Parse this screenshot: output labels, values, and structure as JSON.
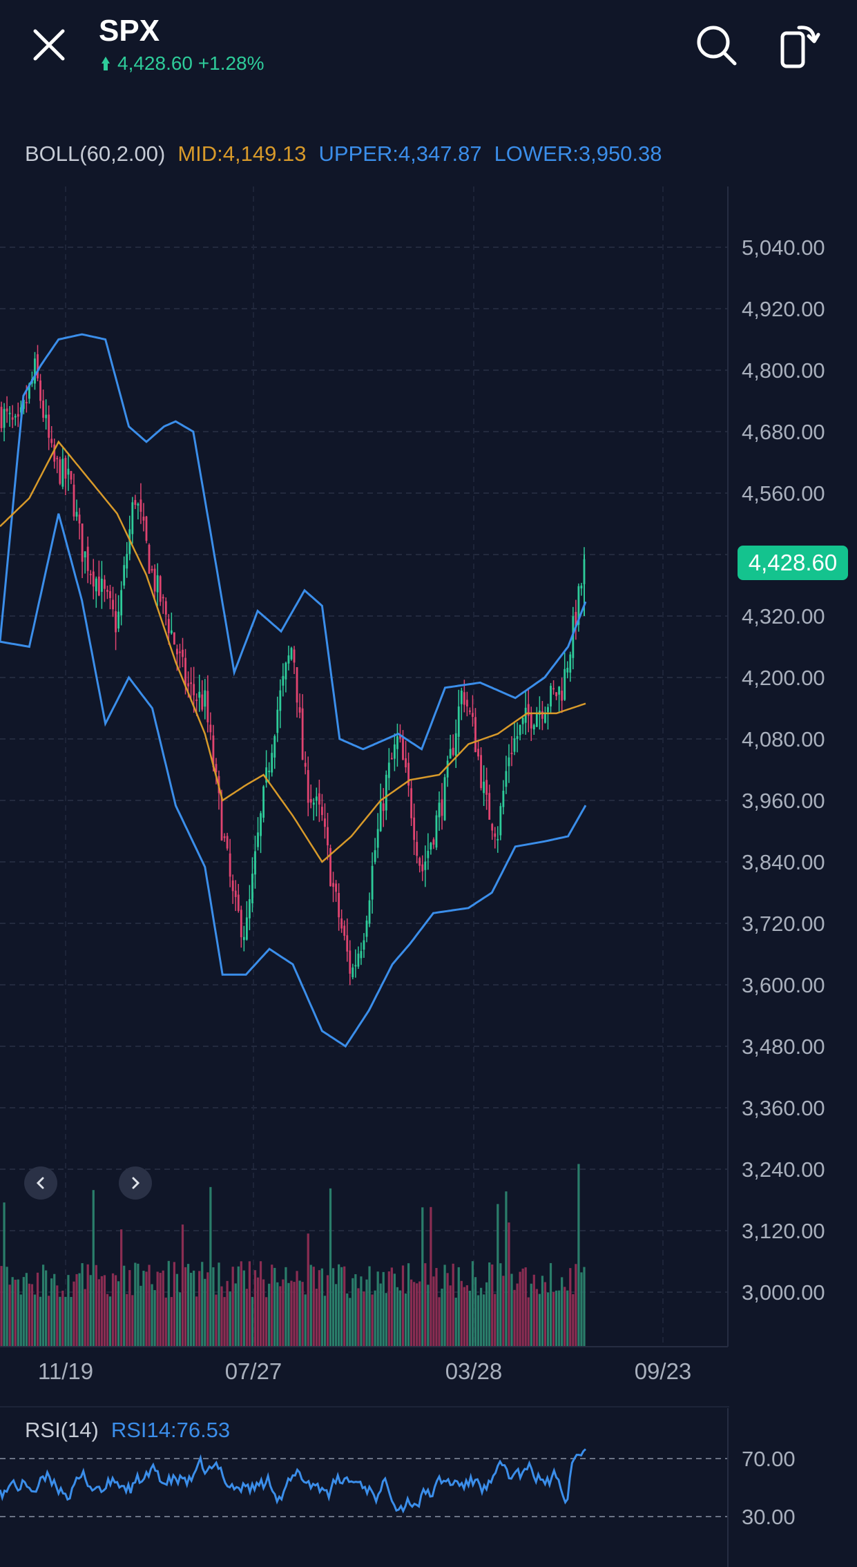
{
  "header": {
    "close_icon": "close-icon",
    "symbol": "SPX",
    "price_change": "4,428.60 +1.28%",
    "up_color": "#2ecc9a",
    "search_icon": "search-icon",
    "rotate_icon": "rotate-screen-icon"
  },
  "indicator": {
    "name": "BOLL(60,2.00)",
    "mid": "MID:4,149.13",
    "upper": "UPPER:4,347.87",
    "lower": "LOWER:3,950.38"
  },
  "current_price": "4,428.60",
  "nav": {
    "prev_icon": "chevron-left-icon",
    "next_icon": "chevron-right-icon"
  },
  "rsi": {
    "name": "RSI(14)",
    "value": "RSI14:76.53"
  },
  "colors": {
    "background": "#101628",
    "up": "#2ecc9a",
    "down": "#e04470",
    "boll_mid": "#d89a2a",
    "boll_band": "#3b8eea",
    "badge": "#14c38e"
  },
  "chart_data": [
    {
      "type": "candlestick",
      "title": "SPX",
      "ylim": [
        2940,
        5100
      ],
      "y_ticks": [
        "5,040.00",
        "4,920.00",
        "4,800.00",
        "4,680.00",
        "4,560.00",
        "4,440.00",
        "4,320.00",
        "4,200.00",
        "4,080.00",
        "3,960.00",
        "3,840.00",
        "3,720.00",
        "3,600.00",
        "3,480.00",
        "3,360.00",
        "3,240.00",
        "3,120.00",
        "3,000.00"
      ],
      "x_ticks": [
        "11/19",
        "07/27",
        "03/28",
        "09/23"
      ],
      "boll_mid": [
        [
          0,
          4495
        ],
        [
          0.05,
          4550
        ],
        [
          0.1,
          4660
        ],
        [
          0.15,
          4590
        ],
        [
          0.2,
          4520
        ],
        [
          0.25,
          4400
        ],
        [
          0.3,
          4230
        ],
        [
          0.35,
          4090
        ],
        [
          0.38,
          3960
        ],
        [
          0.42,
          3990
        ],
        [
          0.45,
          4010
        ],
        [
          0.5,
          3930
        ],
        [
          0.55,
          3840
        ],
        [
          0.6,
          3890
        ],
        [
          0.65,
          3960
        ],
        [
          0.7,
          4000
        ],
        [
          0.75,
          4010
        ],
        [
          0.8,
          4070
        ],
        [
          0.85,
          4090
        ],
        [
          0.9,
          4130
        ],
        [
          0.95,
          4130
        ],
        [
          1.0,
          4149.13
        ]
      ],
      "boll_upper": [
        [
          0,
          4270
        ],
        [
          0.04,
          4750
        ],
        [
          0.07,
          4810
        ],
        [
          0.1,
          4860
        ],
        [
          0.14,
          4870
        ],
        [
          0.18,
          4860
        ],
        [
          0.22,
          4690
        ],
        [
          0.25,
          4660
        ],
        [
          0.28,
          4690
        ],
        [
          0.3,
          4700
        ],
        [
          0.33,
          4680
        ],
        [
          0.36,
          4480
        ],
        [
          0.4,
          4210
        ],
        [
          0.44,
          4330
        ],
        [
          0.48,
          4290
        ],
        [
          0.52,
          4370
        ],
        [
          0.55,
          4340
        ],
        [
          0.58,
          4080
        ],
        [
          0.62,
          4060
        ],
        [
          0.68,
          4090
        ],
        [
          0.72,
          4060
        ],
        [
          0.76,
          4180
        ],
        [
          0.82,
          4190
        ],
        [
          0.88,
          4160
        ],
        [
          0.93,
          4200
        ],
        [
          0.97,
          4260
        ],
        [
          1.0,
          4347.87
        ]
      ],
      "boll_lower": [
        [
          0,
          4270
        ],
        [
          0.05,
          4260
        ],
        [
          0.1,
          4520
        ],
        [
          0.14,
          4350
        ],
        [
          0.18,
          4110
        ],
        [
          0.22,
          4200
        ],
        [
          0.26,
          4140
        ],
        [
          0.3,
          3950
        ],
        [
          0.35,
          3830
        ],
        [
          0.38,
          3620
        ],
        [
          0.42,
          3620
        ],
        [
          0.46,
          3670
        ],
        [
          0.5,
          3640
        ],
        [
          0.55,
          3510
        ],
        [
          0.59,
          3480
        ],
        [
          0.63,
          3550
        ],
        [
          0.67,
          3640
        ],
        [
          0.7,
          3680
        ],
        [
          0.74,
          3740
        ],
        [
          0.8,
          3750
        ],
        [
          0.84,
          3780
        ],
        [
          0.88,
          3870
        ],
        [
          0.93,
          3880
        ],
        [
          0.97,
          3890
        ],
        [
          1.0,
          3950.38
        ]
      ],
      "close_path": [
        [
          0,
          4720
        ],
        [
          0.03,
          4680
        ],
        [
          0.06,
          4800
        ],
        [
          0.09,
          4620
        ],
        [
          0.12,
          4580
        ],
        [
          0.14,
          4450
        ],
        [
          0.17,
          4380
        ],
        [
          0.2,
          4300
        ],
        [
          0.23,
          4560
        ],
        [
          0.26,
          4400
        ],
        [
          0.29,
          4300
        ],
        [
          0.32,
          4180
        ],
        [
          0.35,
          4150
        ],
        [
          0.38,
          3900
        ],
        [
          0.4,
          3750
        ],
        [
          0.42,
          3700
        ],
        [
          0.44,
          3880
        ],
        [
          0.47,
          4120
        ],
        [
          0.5,
          4270
        ],
        [
          0.52,
          4000
        ],
        [
          0.55,
          3920
        ],
        [
          0.57,
          3780
        ],
        [
          0.6,
          3620
        ],
        [
          0.62,
          3700
        ],
        [
          0.64,
          3860
        ],
        [
          0.66,
          4000
        ],
        [
          0.68,
          4080
        ],
        [
          0.7,
          3960
        ],
        [
          0.72,
          3820
        ],
        [
          0.74,
          3900
        ],
        [
          0.76,
          3980
        ],
        [
          0.79,
          4180
        ],
        [
          0.81,
          4090
        ],
        [
          0.83,
          3950
        ],
        [
          0.85,
          3900
        ],
        [
          0.87,
          4060
        ],
        [
          0.9,
          4120
        ],
        [
          0.93,
          4150
        ],
        [
          0.96,
          4180
        ],
        [
          0.98,
          4300
        ],
        [
          1.0,
          4428.6
        ]
      ],
      "volume_ylim": [
        2950,
        3180
      ]
    },
    {
      "type": "line",
      "title": "RSI(14)",
      "y_ticks": [
        "70.00",
        "30.00"
      ],
      "ylim": [
        20,
        90
      ],
      "last_value": 76.53
    }
  ]
}
